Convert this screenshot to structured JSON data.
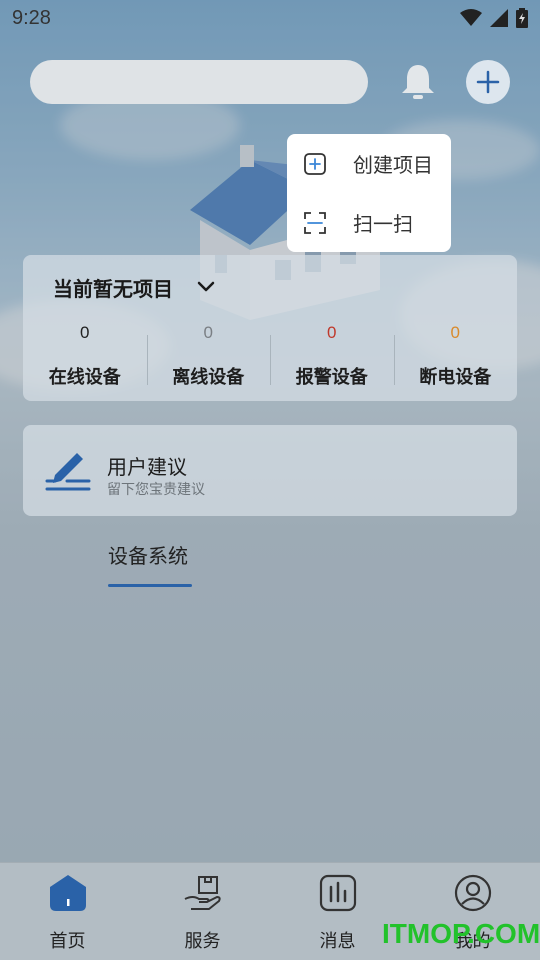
{
  "status_bar": {
    "time": "9:28"
  },
  "popup_menu": {
    "items": [
      {
        "label": "创建项目",
        "icon": "add-square-icon"
      },
      {
        "label": "扫一扫",
        "icon": "scan-icon"
      }
    ]
  },
  "project_card": {
    "title": "当前暂无项目",
    "stats": [
      {
        "value": "0",
        "label": "在线设备",
        "color": "#222222"
      },
      {
        "value": "0",
        "label": "离线设备",
        "color": "#7a7f84"
      },
      {
        "value": "0",
        "label": "报警设备",
        "color": "#c0392b"
      },
      {
        "value": "0",
        "label": "断电设备",
        "color": "#d98a2b"
      }
    ]
  },
  "suggestion": {
    "title": "用户建议",
    "subtitle": "留下您宝贵建议"
  },
  "tabs": [
    {
      "label": "设备系统",
      "active": true
    }
  ],
  "bottom_nav": {
    "items": [
      {
        "label": "首页",
        "icon": "home-icon",
        "active": true
      },
      {
        "label": "服务",
        "icon": "service-hand-icon",
        "active": false
      },
      {
        "label": "消息",
        "icon": "message-chart-icon",
        "active": false
      },
      {
        "label": "我的",
        "icon": "profile-icon",
        "active": false
      }
    ]
  },
  "watermark": "ITMOP.COM",
  "colors": {
    "accent": "#2a62a8",
    "menu_icon": "#3a86d8"
  }
}
